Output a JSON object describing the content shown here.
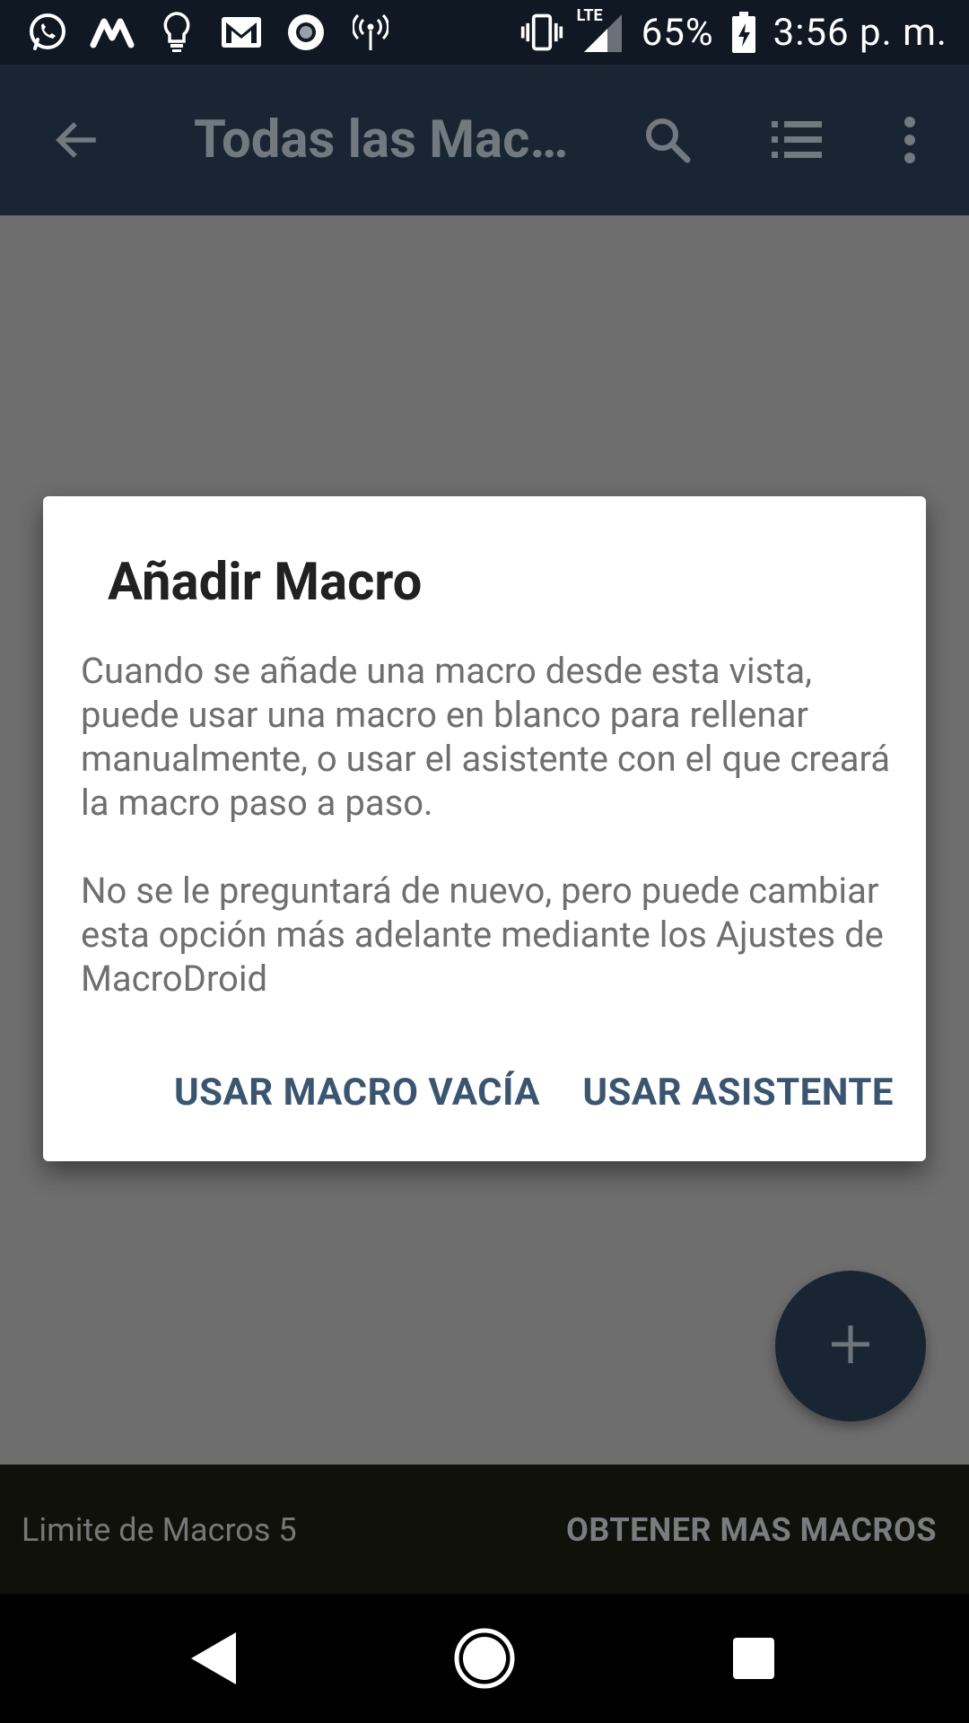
{
  "status_bar": {
    "battery_percent": "65%",
    "time": "3:56 p. m.",
    "network_label": "LTE",
    "icons": [
      "whatsapp-icon",
      "m-app-icon",
      "bulb-icon",
      "gmail-icon",
      "record-icon",
      "hotspot-icon",
      "vibrate-icon",
      "signal-icon",
      "battery-charging-icon"
    ]
  },
  "app_bar": {
    "title": "Todas las Mac…",
    "icons": [
      "back-arrow-icon",
      "search-icon",
      "list-icon",
      "more-vert-icon"
    ]
  },
  "dialog": {
    "title": "Añadir Macro",
    "paragraph_1": "Cuando se añade una macro desde esta vista, puede usar una macro en blanco para rellenar manualmente, o usar el asistente con el que creará la macro paso a paso.",
    "paragraph_2": "No se le preguntará de nuevo, pero puede cambiar esta opción más adelante mediante los Ajustes de MacroDroid",
    "empty_macro_button": "USAR MACRO VACÍA",
    "wizard_button": "USAR ASISTENTE"
  },
  "bottom_bar": {
    "limit_text": "Limite de Macros 5",
    "more_button": "OBTENER MAS MACROS"
  },
  "nav_bar": {
    "icons": [
      "nav-back-icon",
      "nav-home-icon",
      "nav-recents-icon"
    ]
  },
  "colors": {
    "status_bar_bg": "#0f1823",
    "app_bar_bg": "#1a2533",
    "scrim_bg": "#6e6e6e",
    "dialog_button": "#3a5570",
    "fab_bg": "#1a2533"
  }
}
